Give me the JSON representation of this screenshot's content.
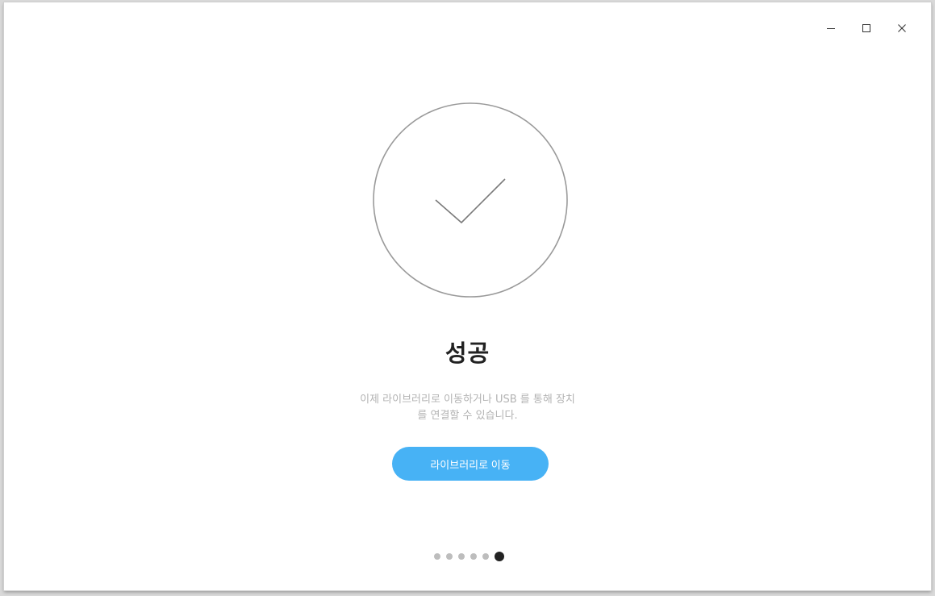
{
  "window_controls": {
    "minimize_icon": "minimize-icon",
    "maximize_icon": "maximize-icon",
    "close_icon": "close-icon"
  },
  "success": {
    "icon": "checkmark-circle-icon",
    "title": "성공",
    "message_line1": "이제 라이브러리로 이동하거나 USB 를 통해 장치",
    "message_line2": "를 연결할 수 있습니다.",
    "button_label": "라이브러리로 이동",
    "button_color": "#47b2f5"
  },
  "pager": {
    "total_steps": 6,
    "current_step": 6
  }
}
